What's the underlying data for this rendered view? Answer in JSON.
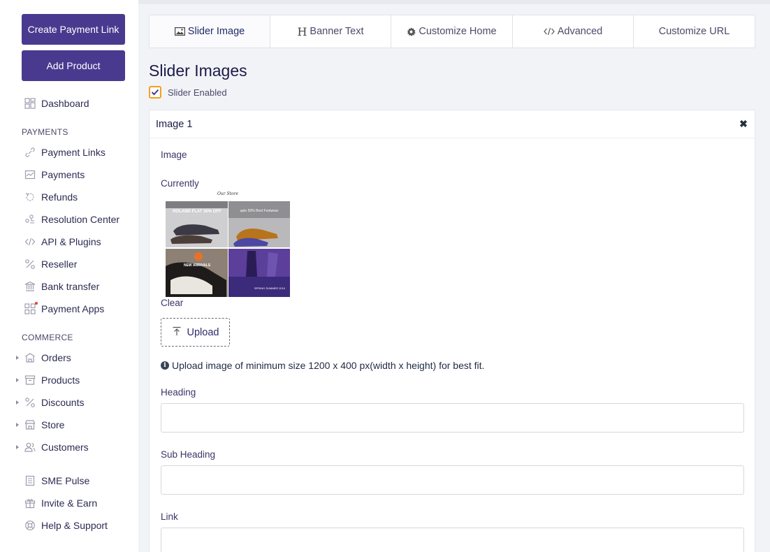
{
  "sidebar": {
    "create_payment_link": "Create Payment Link",
    "add_product": "Add Product",
    "dashboard": "Dashboard",
    "payments_section": "PAYMENTS",
    "payments_items": [
      {
        "label": "Payment Links",
        "icon": "link-icon"
      },
      {
        "label": "Payments",
        "icon": "chart-icon"
      },
      {
        "label": "Refunds",
        "icon": "refund-icon"
      },
      {
        "label": "Resolution Center",
        "icon": "resolution-icon"
      },
      {
        "label": "API & Plugins",
        "icon": "code-icon"
      },
      {
        "label": "Reseller",
        "icon": "percent-icon"
      },
      {
        "label": "Bank transfer",
        "icon": "bank-icon"
      },
      {
        "label": "Payment Apps",
        "icon": "apps-icon"
      }
    ],
    "commerce_section": "COMMERCE",
    "commerce_items": [
      {
        "label": "Orders",
        "icon": "orders-icon"
      },
      {
        "label": "Products",
        "icon": "box-icon"
      },
      {
        "label": "Discounts",
        "icon": "percent-icon"
      },
      {
        "label": "Store",
        "icon": "store-icon"
      },
      {
        "label": "Customers",
        "icon": "users-icon"
      }
    ],
    "bottom_items": [
      {
        "label": "SME Pulse",
        "icon": "news-icon"
      },
      {
        "label": "Invite & Earn",
        "icon": "gift-icon"
      },
      {
        "label": "Help & Support",
        "icon": "lifebuoy-icon"
      }
    ]
  },
  "tabs": [
    {
      "label": "Slider Image",
      "icon": "image-icon",
      "active": true
    },
    {
      "label": "Banner Text",
      "icon": "heading-icon",
      "active": false
    },
    {
      "label": "Customize Home",
      "icon": "gear-icon",
      "active": false
    },
    {
      "label": "Advanced",
      "icon": "code-icon",
      "active": false
    },
    {
      "label": "Customize URL",
      "icon": "",
      "active": false
    }
  ],
  "main": {
    "title": "Slider Images",
    "slider_enabled_label": "Slider Enabled",
    "slider_enabled": true,
    "panel": {
      "title": "Image 1",
      "image_label": "Image",
      "currently_label": "Currently",
      "thumb_caption_top": "Our Store",
      "thumb_tiles": [
        {
          "text": "ROLAND FLAT 30% OFF",
          "bg": "#cfcfd2"
        },
        {
          "text": "upto 50% Best Footwear",
          "bg": "#b9b9bc"
        },
        {
          "text": "NEW ARRIVALS",
          "bg": "#8c8174"
        },
        {
          "text": "SPRING SUMMER 2019",
          "bg": "#3c2a7a"
        }
      ],
      "clear_label": "Clear",
      "upload_label": "Upload",
      "hint": "Upload image of minimum size 1200 x 400 px(width x height) for best fit.",
      "heading_label": "Heading",
      "heading_value": "",
      "sub_heading_label": "Sub Heading",
      "sub_heading_value": "",
      "link_label": "Link",
      "link_value": ""
    }
  },
  "colors": {
    "primary": "#4a3a8f",
    "checkbox_border": "#f0a11a",
    "page_bg": "#f2f3f7"
  }
}
